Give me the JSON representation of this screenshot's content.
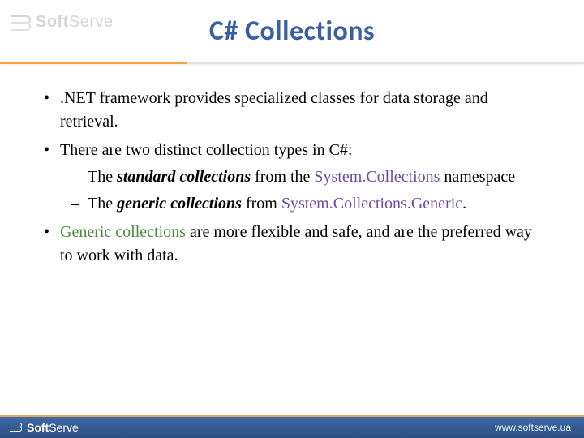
{
  "brand": {
    "name_bold": "Soft",
    "name_light": "Serve",
    "url": "www.softserve.ua"
  },
  "title": "C# Collections",
  "bullets": {
    "b1": ".NET framework provides specialized classes for data storage and retrieval.",
    "b2": "There are two distinct collection types in C#:",
    "b2a_pre": "The ",
    "b2a_em": "standard collections",
    "b2a_mid": " from the ",
    "b2a_ns": "System.Collections",
    "b2a_post": " namespace",
    "b2b_pre": "The ",
    "b2b_em": "generic collections",
    "b2b_mid": "  from ",
    "b2b_ns": "System.Collections.Generic",
    "b2b_post": ".",
    "b3_pre": " ",
    "b3_gc": "Generic collections",
    "b3_post": " are more flexible and safe, and are the preferred way to work with data."
  }
}
